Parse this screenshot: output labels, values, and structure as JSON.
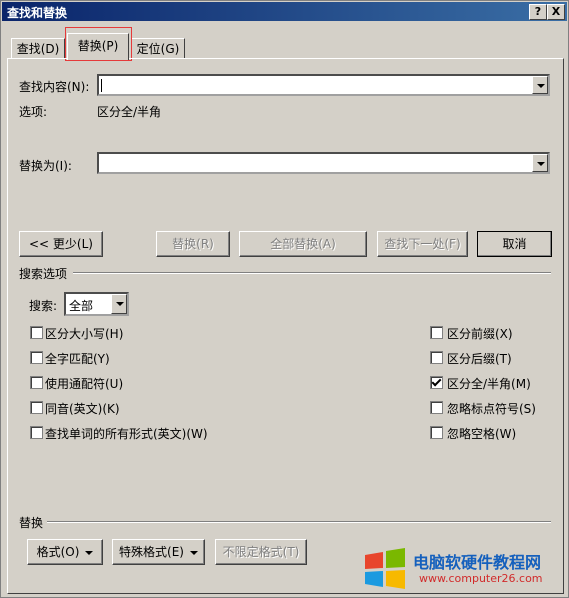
{
  "window": {
    "title": "查找和替换",
    "help": "?",
    "close": "X"
  },
  "tabs": [
    {
      "label": "查找(D)"
    },
    {
      "label": "替换(P)"
    },
    {
      "label": "定位(G)"
    }
  ],
  "find": {
    "label": "查找内容(N):",
    "value": "",
    "options_label": "选项:",
    "options_value": "区分全/半角"
  },
  "replace": {
    "label": "替换为(I):",
    "value": ""
  },
  "buttons": {
    "less": "<< 更少(L)",
    "replace": "替换(R)",
    "replace_all": "全部替换(A)",
    "find_next": "查找下一处(F)",
    "cancel": "取消"
  },
  "search_options": {
    "title": "搜索选项",
    "search_label": "搜索:",
    "search_value": "全部",
    "left": [
      {
        "label": "区分大小写(H)",
        "checked": false
      },
      {
        "label": "全字匹配(Y)",
        "checked": false
      },
      {
        "label": "使用通配符(U)",
        "checked": false
      },
      {
        "label": "同音(英文)(K)",
        "checked": false
      },
      {
        "label": "查找单词的所有形式(英文)(W)",
        "checked": false
      }
    ],
    "right": [
      {
        "label": "区分前缀(X)",
        "checked": false
      },
      {
        "label": "区分后缀(T)",
        "checked": false
      },
      {
        "label": "区分全/半角(M)",
        "checked": true
      },
      {
        "label": "忽略标点符号(S)",
        "checked": false
      },
      {
        "label": "忽略空格(W)",
        "checked": false
      }
    ]
  },
  "replace_section": {
    "title": "替换",
    "format": "格式(O)",
    "special": "特殊格式(E)",
    "no_format": "不限定格式(T)"
  },
  "watermark": {
    "text": "电脑软硬件教程网",
    "url": "www.computer26.com"
  },
  "colors": {
    "title_start": "#0a246a",
    "title_end": "#3a6ea5",
    "highlight": "#e53a3a",
    "face": "#d4d0c8"
  }
}
